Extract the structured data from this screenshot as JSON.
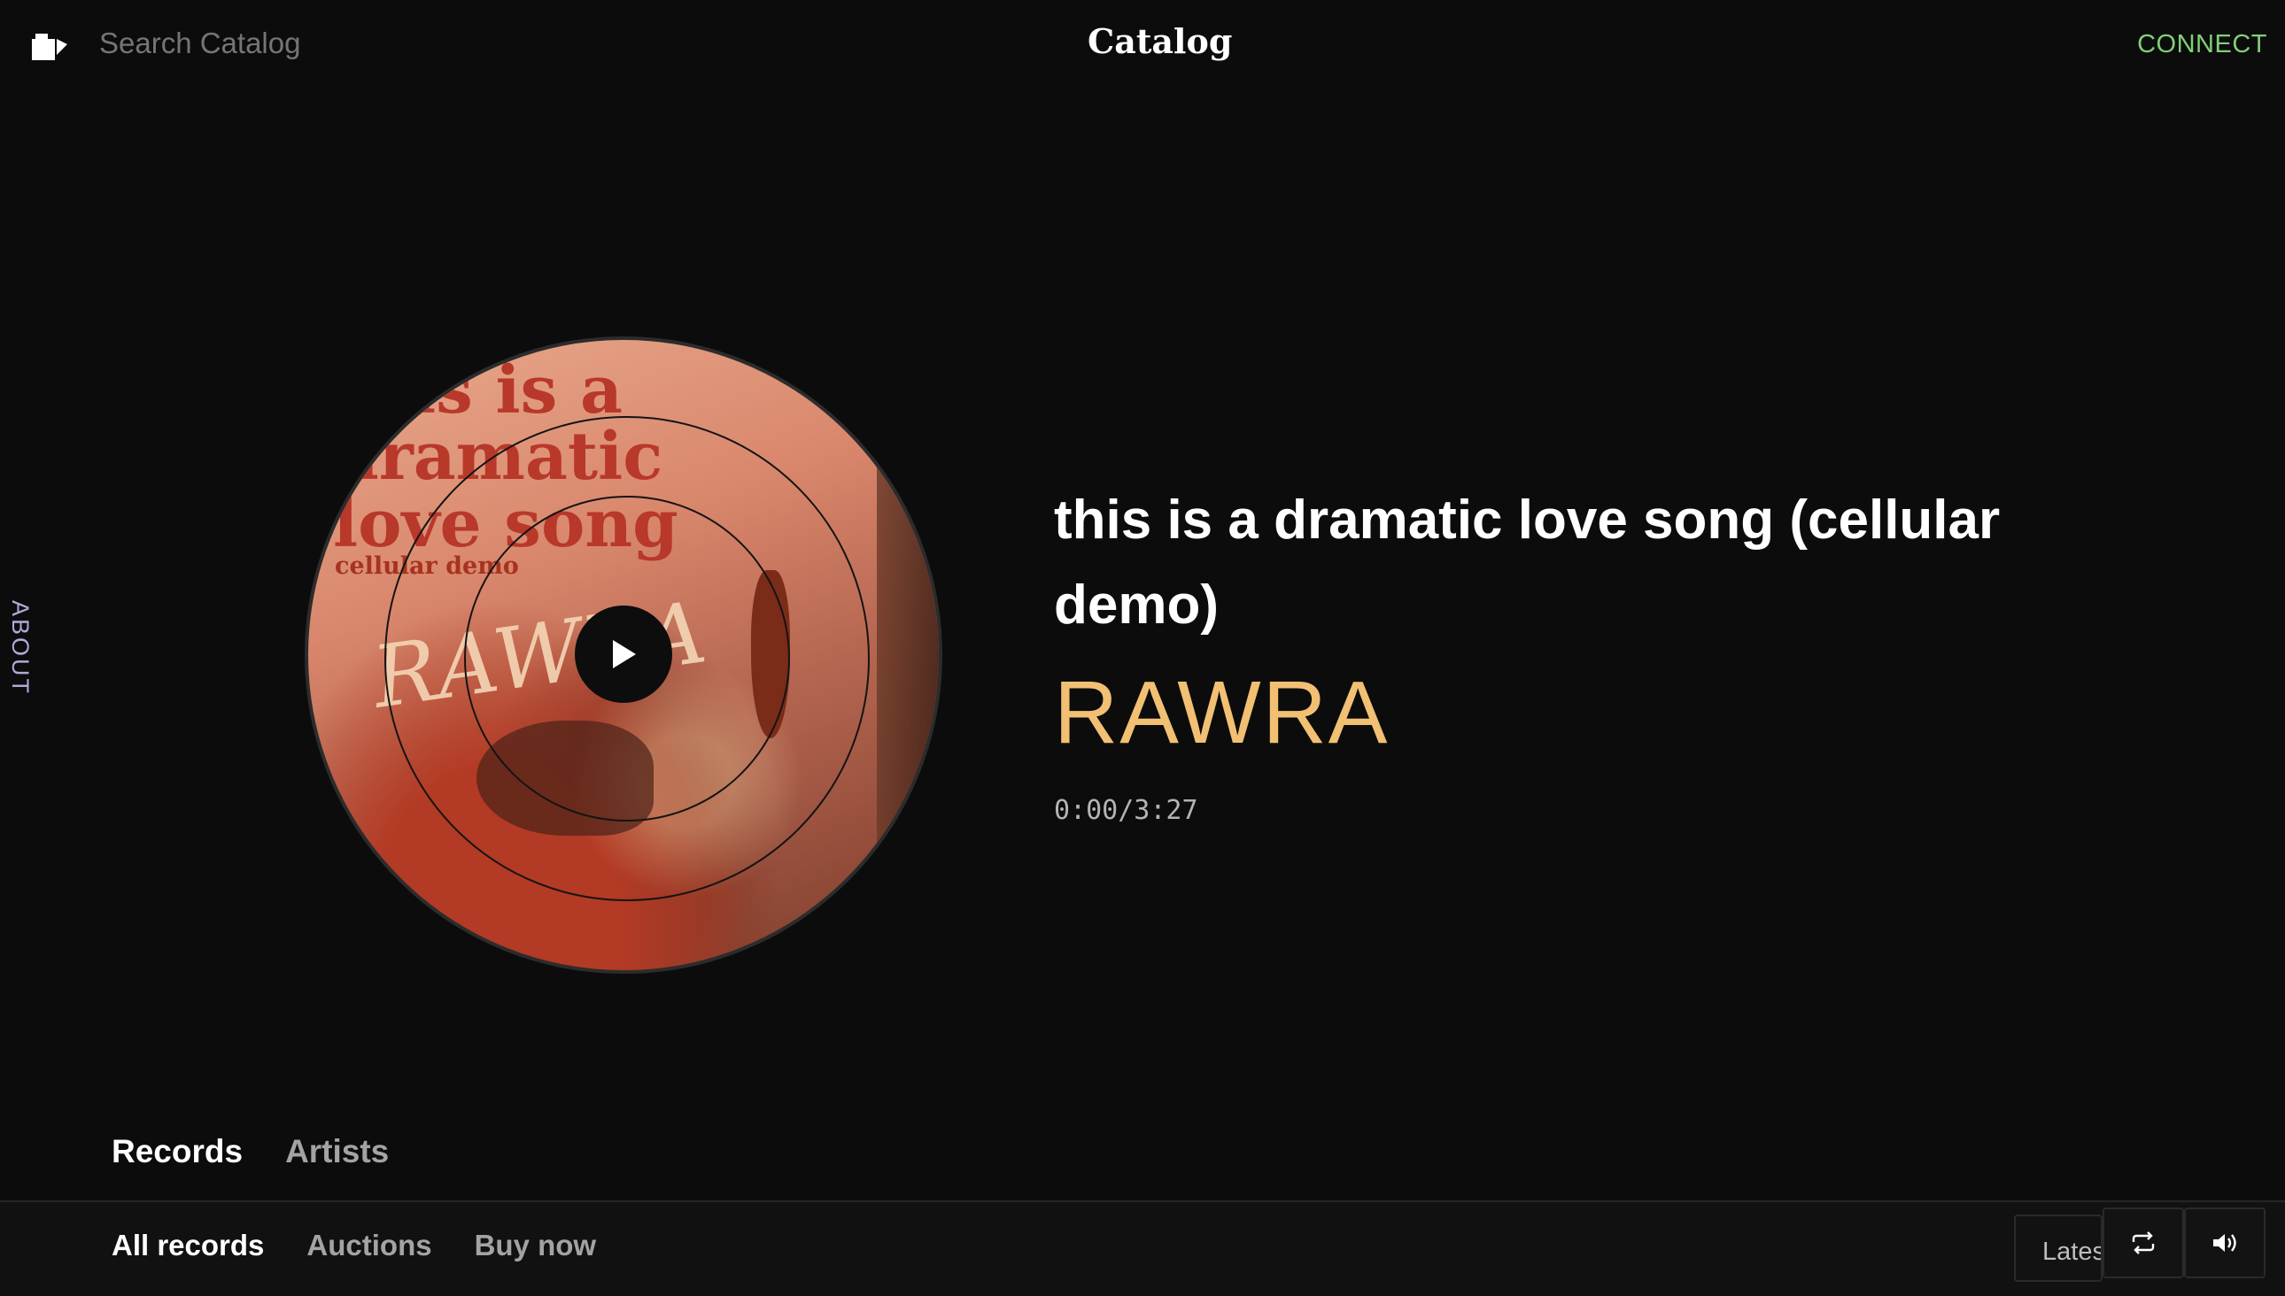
{
  "header": {
    "search_placeholder": "Search Catalog",
    "brand": "Catalog",
    "connect_label": "CONNECT"
  },
  "side": {
    "about_label": "ABOUT"
  },
  "cover": {
    "lines": "this is a\ndramatic\nlove song",
    "subtitle": "cellular demo",
    "scrawl": "RAWRA"
  },
  "player": {
    "title": "this is a dramatic love song (cellular demo)",
    "artist": "RAWRA",
    "time": "0:00/3:27"
  },
  "tabs": [
    {
      "label": "Records",
      "active": true
    },
    {
      "label": "Artists",
      "active": false
    }
  ],
  "filters": [
    {
      "label": "All records",
      "active": true
    },
    {
      "label": "Auctions",
      "active": false
    },
    {
      "label": "Buy now",
      "active": false
    }
  ],
  "sort": {
    "label": "Latest"
  },
  "icons": {
    "logo": "catalog-logo-icon",
    "play": "play-icon",
    "repeat": "repeat-icon",
    "volume": "volume-icon"
  },
  "colors": {
    "background": "#0c0c0c",
    "connect": "#7fd075",
    "artist": "#f1c073",
    "about": "#b0a9d9"
  }
}
